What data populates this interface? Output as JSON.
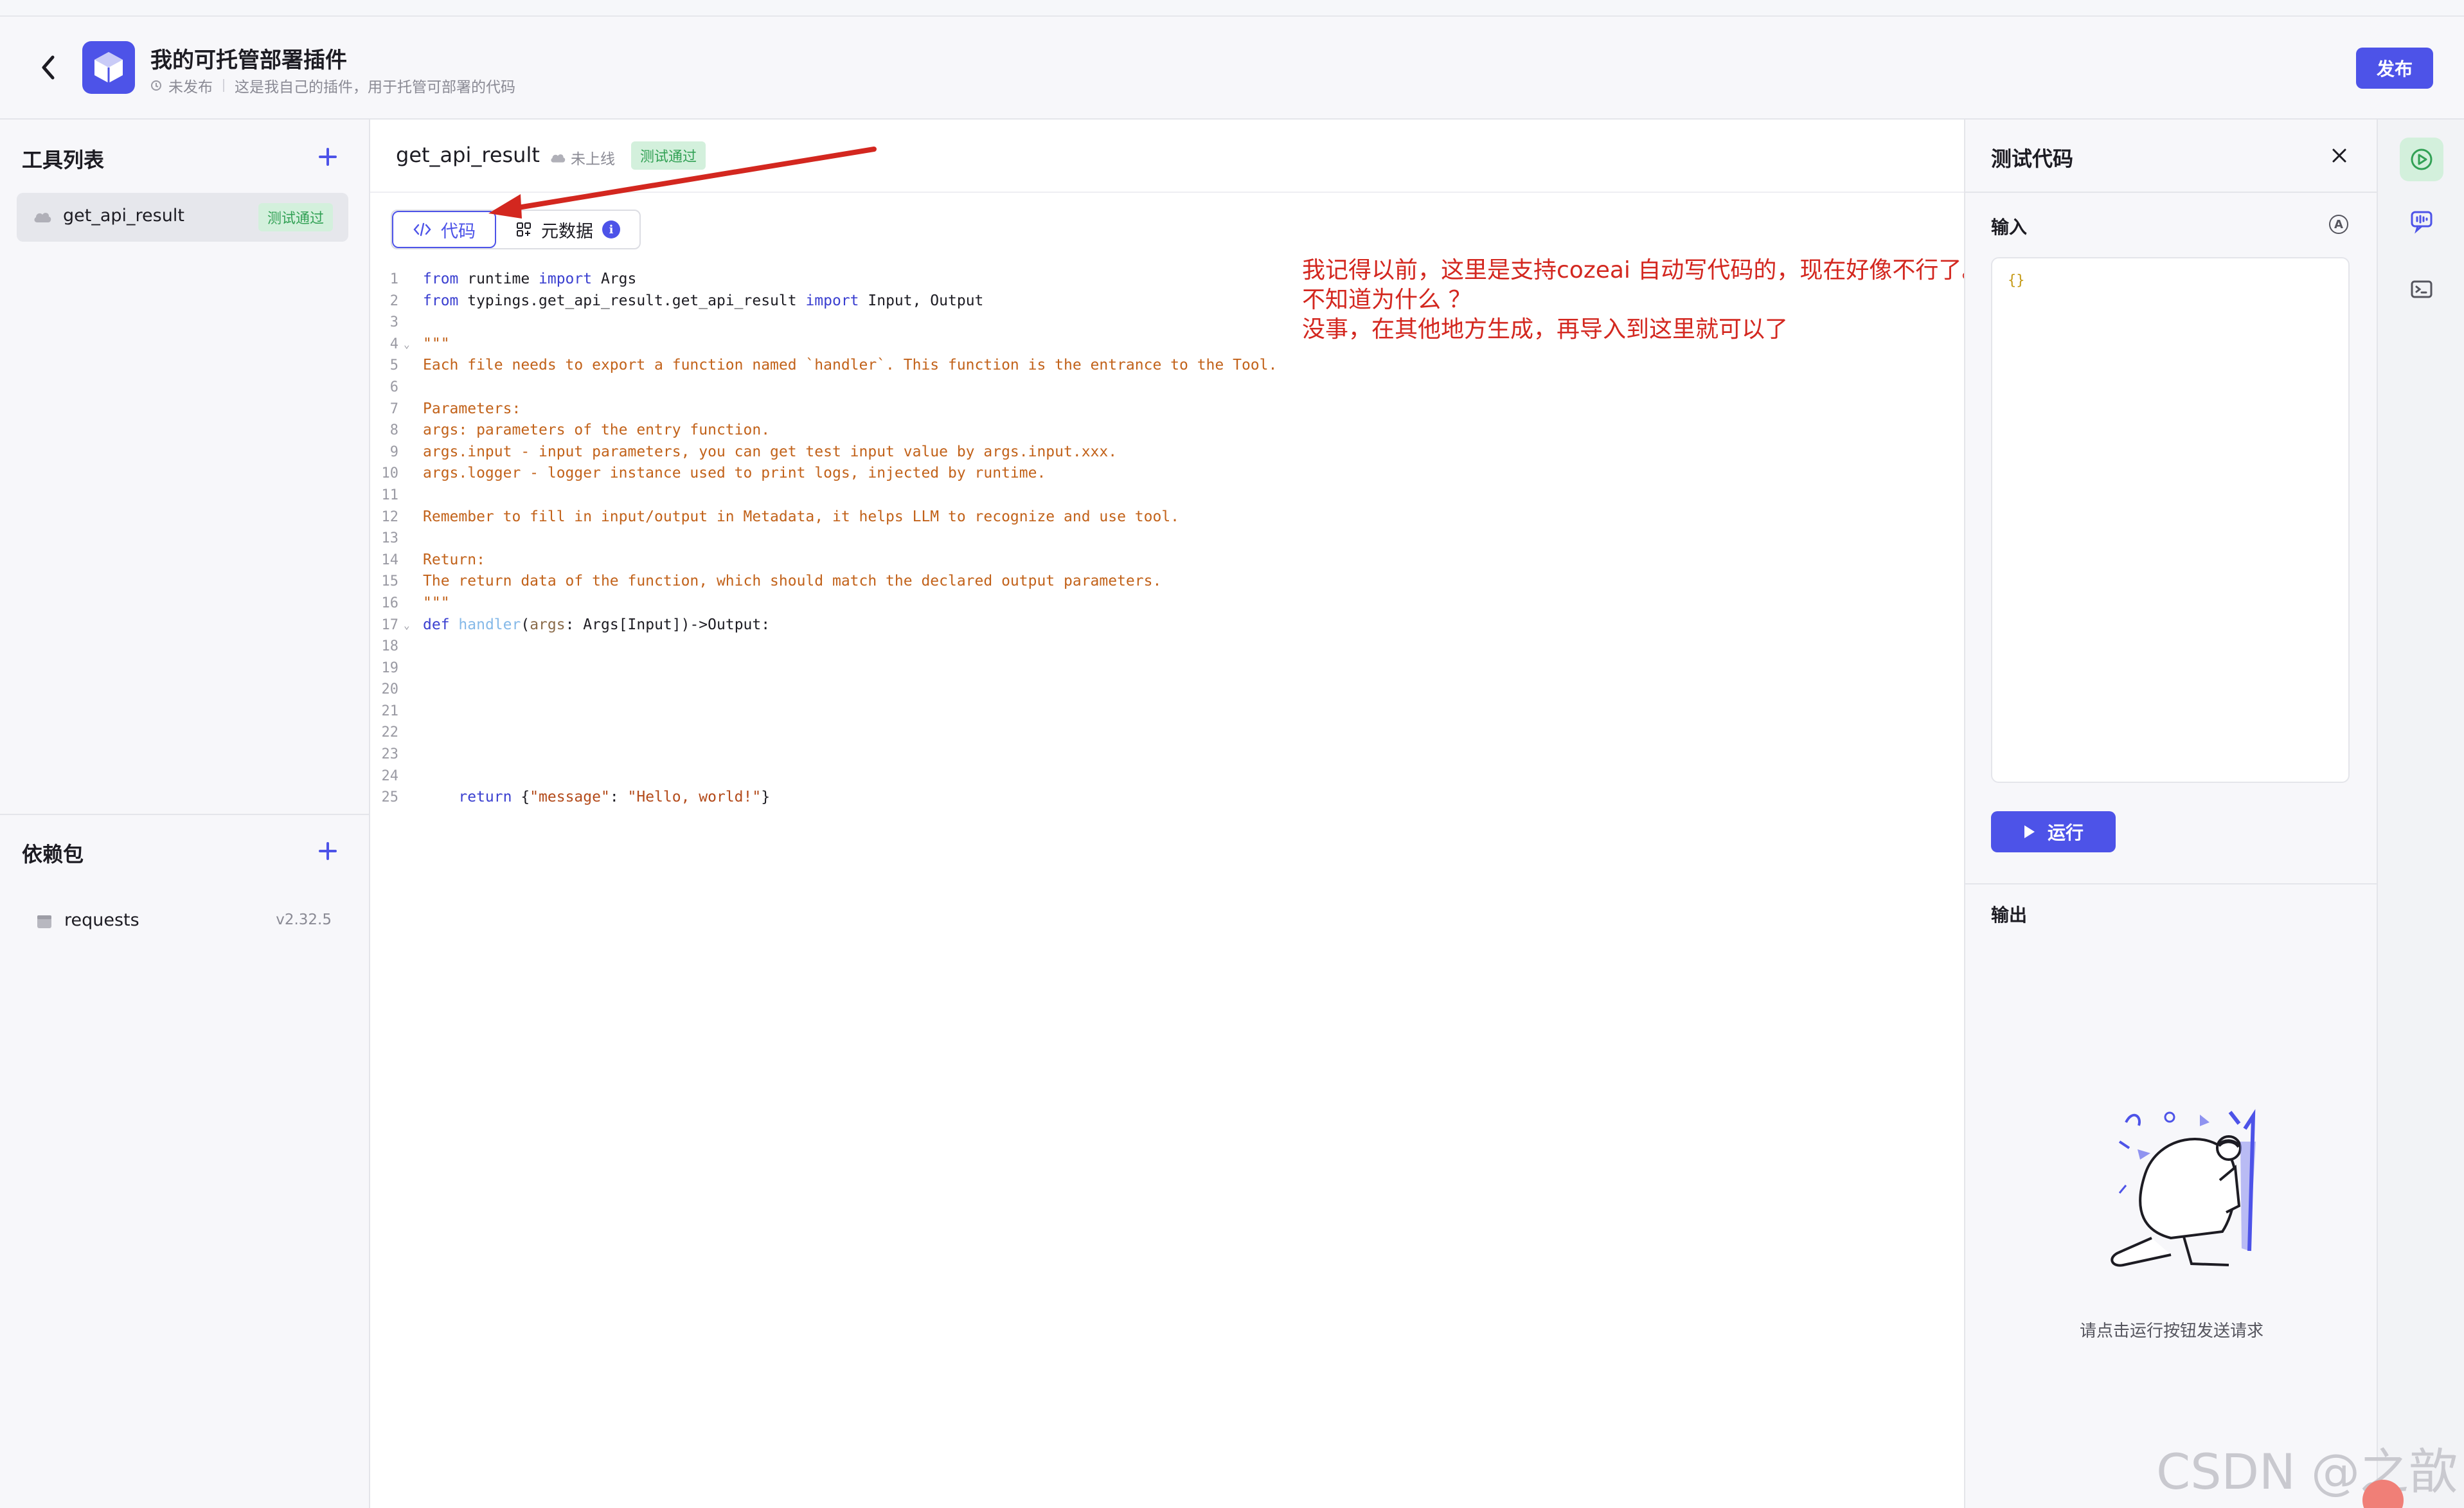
{
  "header": {
    "title": "我的可托管部署插件",
    "status": "未发布",
    "description": "这是我自己的插件，用于托管可部署的代码",
    "publish_label": "发布"
  },
  "sidebar": {
    "tools_title": "工具列表",
    "tools": [
      {
        "name": "get_api_result",
        "badge": "测试通过"
      }
    ],
    "deps_title": "依赖包",
    "deps": [
      {
        "name": "requests",
        "version": "v2.32.5"
      }
    ]
  },
  "editor": {
    "tool_name": "get_api_result",
    "status": "未上线",
    "badge": "测试通过",
    "tabs": [
      {
        "label": "代码",
        "active": true
      },
      {
        "label": "元数据",
        "active": false
      }
    ]
  },
  "annotation": {
    "line1": "我记得以前，这里是支持cozeai 自动写代码的，现在好像不行了。",
    "line2": "不知道为什么 ？",
    "line3": "没事，在其他地方生成，再导入到这里就可以了"
  },
  "test_panel": {
    "title": "测试代码",
    "input_label": "输入",
    "input_value": "{}",
    "run_label": "运行",
    "output_label": "输出",
    "empty_hint": "请点击运行按钮发送请求"
  },
  "watermark": "CSDN @之歆",
  "colors": {
    "brand": "#4d53e8",
    "success_bg": "#d3f0dc",
    "success_text": "#32a155",
    "annotation": "#d3271f"
  },
  "icons": [
    "back-arrow-icon",
    "cube-logo-icon",
    "plus-icon",
    "cloud-icon",
    "package-icon",
    "code-icon",
    "grid-icon",
    "info-icon",
    "close-icon",
    "ai-icon",
    "play-icon",
    "debug-icon",
    "chat-icon",
    "terminal-icon"
  ]
}
